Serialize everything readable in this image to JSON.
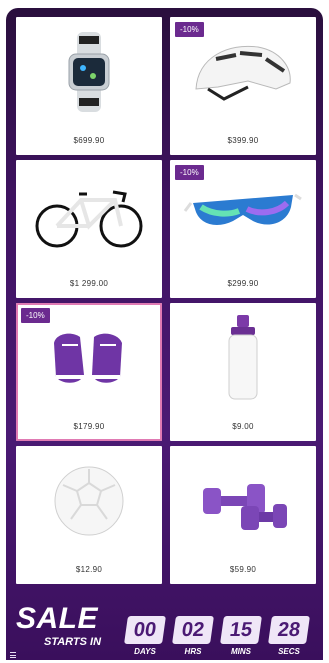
{
  "products": [
    {
      "name": "smartwatch",
      "price": "$699.90",
      "badge": ""
    },
    {
      "name": "helmet",
      "price": "$399.90",
      "badge": "-10%"
    },
    {
      "name": "road-bike",
      "price": "$1 299.00",
      "badge": ""
    },
    {
      "name": "sunglasses",
      "price": "$299.90",
      "badge": "-10%"
    },
    {
      "name": "sneakers",
      "price": "$179.90",
      "badge": "-10%"
    },
    {
      "name": "water-bottle",
      "price": "$9.00",
      "badge": ""
    },
    {
      "name": "soccer-ball",
      "price": "$12.90",
      "badge": ""
    },
    {
      "name": "dumbbells",
      "price": "$59.90",
      "badge": ""
    }
  ],
  "sale": {
    "title": "SALE",
    "subtitle": "STARTS IN",
    "countdown": [
      {
        "value": "00",
        "label": "DAYS"
      },
      {
        "value": "02",
        "label": "HRS"
      },
      {
        "value": "15",
        "label": "MINS"
      },
      {
        "value": "28",
        "label": "SECS"
      }
    ]
  },
  "colors": {
    "accent": "#4b1a74",
    "badge": "#6b2a8f",
    "selected_border": "#e07ab3"
  }
}
